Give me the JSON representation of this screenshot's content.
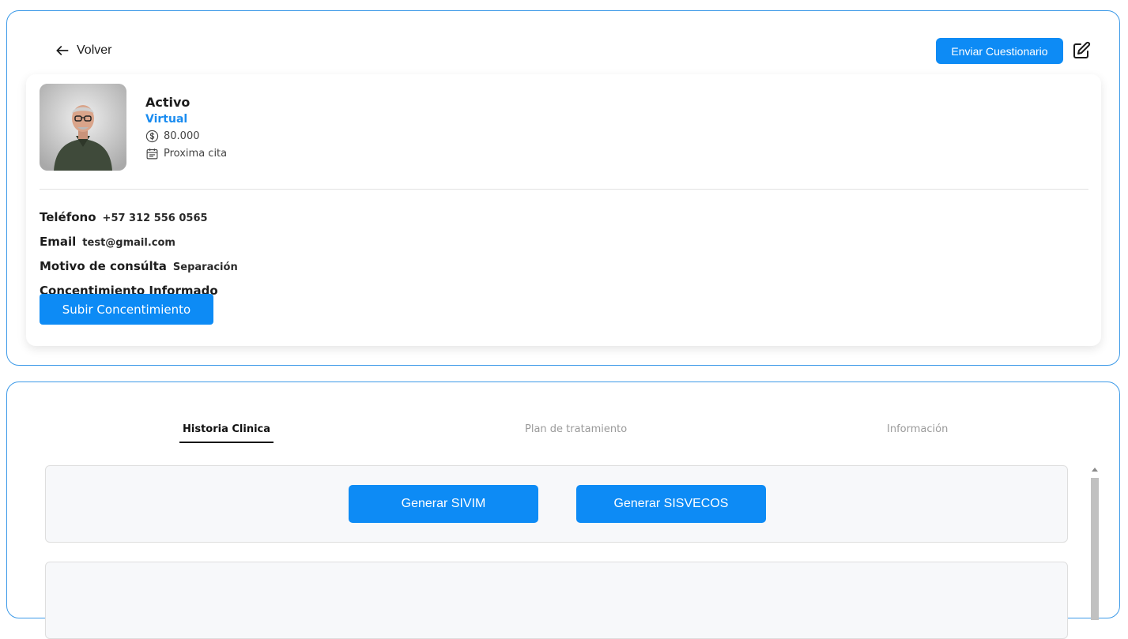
{
  "header": {
    "back_label": "Volver",
    "send_button": "Enviar Cuestionario"
  },
  "profile": {
    "status": "Activo",
    "mode": "Virtual",
    "price": "80.000",
    "next_appointment": "Proxima cita"
  },
  "fields": {
    "phone_label": "Teléfono",
    "phone_value": "+57 312 556 0565",
    "email_label": "Email",
    "email_value": "test@gmail.com",
    "reason_label": "Motivo de consúlta",
    "reason_value": "Separación",
    "consent_label": "Concentimiento Informado",
    "upload_button": "Subir Concentimiento"
  },
  "tabs": [
    {
      "label": "Historia Clinica",
      "active": true
    },
    {
      "label": "Plan de tratamiento",
      "active": false
    },
    {
      "label": "Información",
      "active": false
    }
  ],
  "actions": {
    "sivim_button": "Generar SIVIM",
    "sisvecos_button": "Generar SISVECOS"
  },
  "colors": {
    "accent": "#0d8bf5",
    "card_border": "#3d9ae8",
    "mode_text": "#1a8cf0"
  }
}
